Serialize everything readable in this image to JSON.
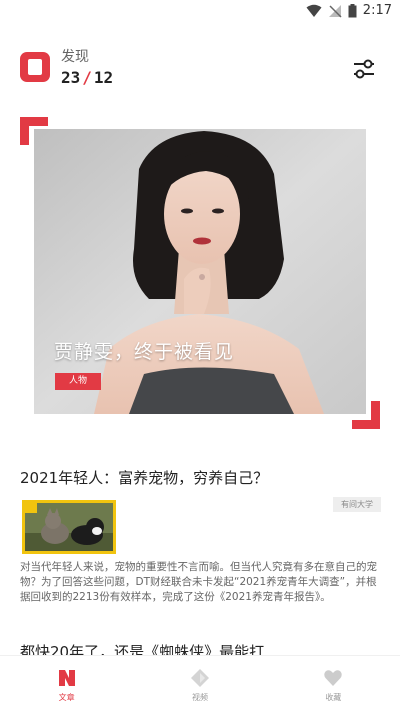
{
  "statusbar": {
    "time": "2:17"
  },
  "header": {
    "title": "发现",
    "current": "23",
    "separator": "/",
    "total": "12"
  },
  "hero": {
    "title": "贾静雯，终于被看见",
    "tag": "人物"
  },
  "article": {
    "title": "2021年轻人：富养宠物，穷养自己？",
    "source": "有间大学",
    "description": "对当代年轻人来说，宠物的重要性不言而喻。但当代人究竟有多在意自己的宠物？为了回答这些问题，DT财经联合未卡发起“2021养宠青年大调查”，并根据回收到的2213份有效样本，完成了这份《2021养宠青年报告》。"
  },
  "next_article": {
    "title": "都快20年了，还是《蜘蛛侠》最能打"
  },
  "nav": {
    "items": [
      {
        "label": "文章",
        "icon": "article-icon"
      },
      {
        "label": "视频",
        "icon": "video-icon"
      },
      {
        "label": "收藏",
        "icon": "heart-icon"
      }
    ]
  },
  "colors": {
    "accent": "#e23a44",
    "thumb_border": "#f1c40f"
  }
}
